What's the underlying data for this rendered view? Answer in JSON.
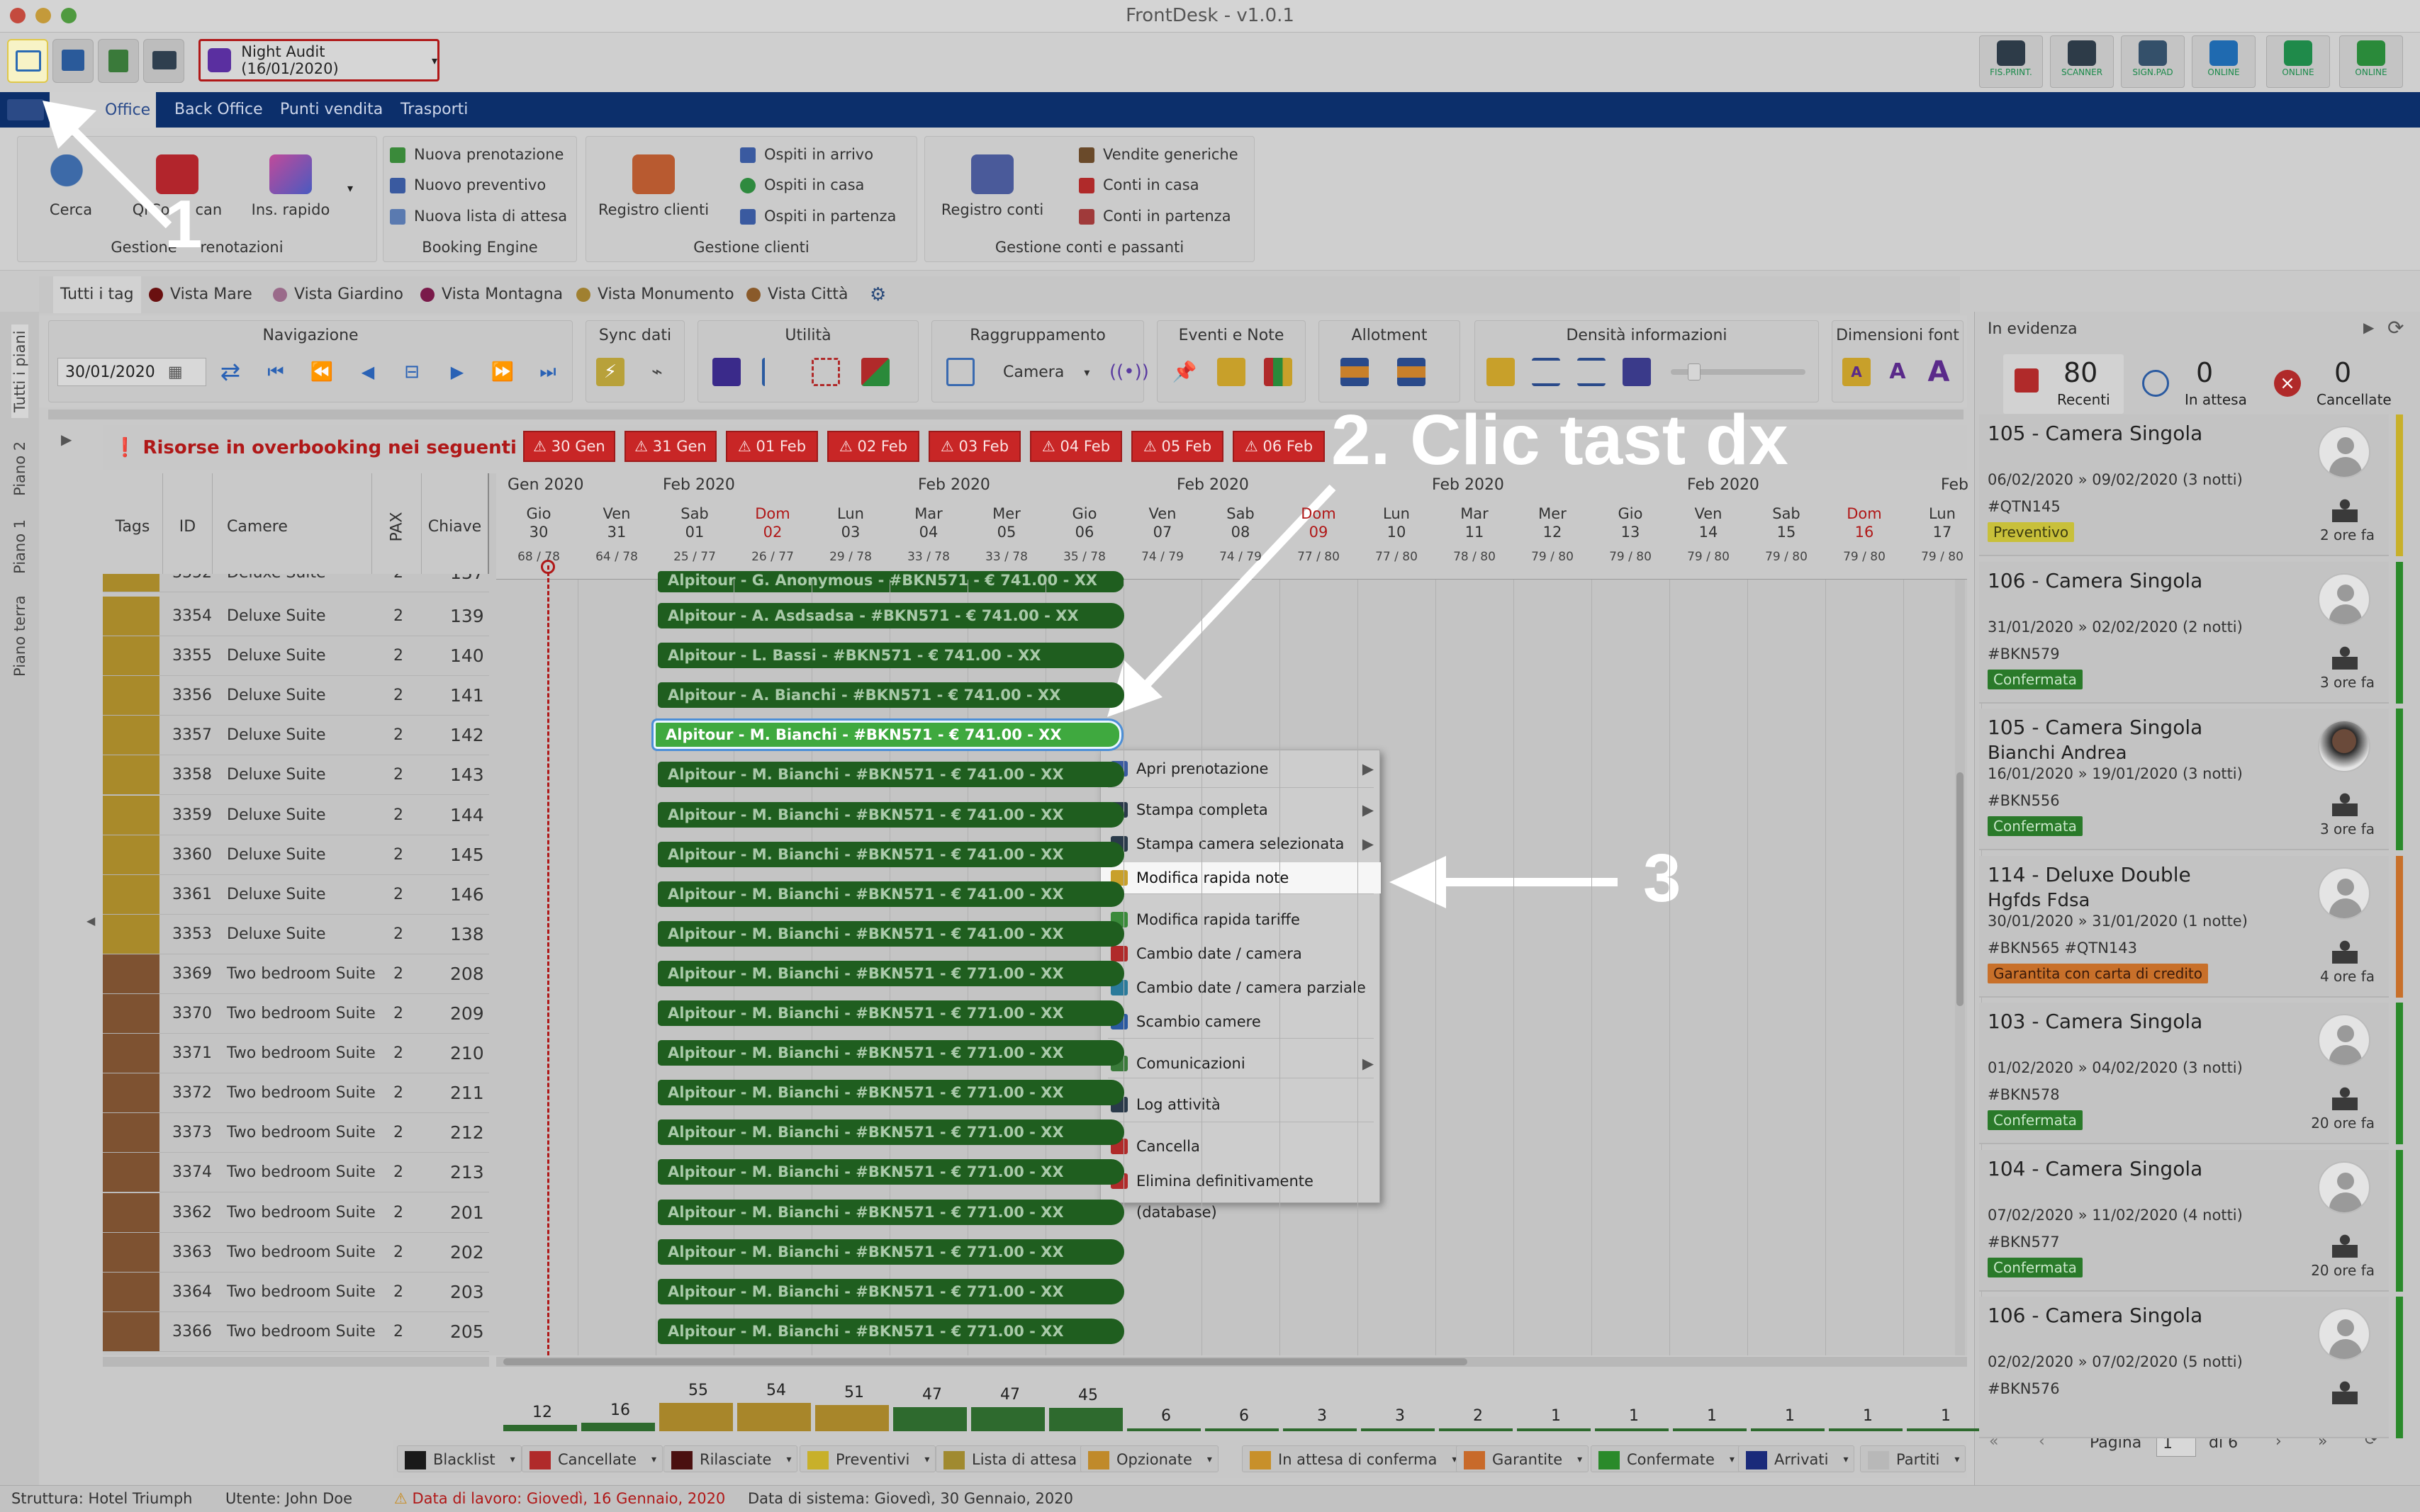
{
  "window": {
    "title": "FrontDesk - v1.0.1"
  },
  "toolbar": {
    "night_audit": "Night Audit (16/01/2020)",
    "right_buttons": [
      "FIS.PRINT.",
      "SCANNER",
      "SIGN.PAD",
      "ONLINE",
      "ONLINE",
      "ONLINE"
    ]
  },
  "menu": {
    "items": [
      "Front Office",
      "Back Office",
      "Punti vendita",
      "Trasporti"
    ],
    "first_visible": "Office"
  },
  "ribbon": {
    "cerca": "Cerca",
    "qrcode": "QrCode scan",
    "qrcode_a": "QrCo",
    "qrcode_b": "can",
    "ins_rapido": "Ins. rapido",
    "gestione_prenotazioni": "Gestione prenotazioni",
    "gp_a": "Gestione",
    "gp_b": "renotazioni",
    "nuova_prenotazione": "Nuova prenotazione",
    "nuovo_preventivo": "Nuovo preventivo",
    "nuova_lista": "Nuova lista di attesa",
    "booking_engine": "Booking Engine",
    "registro_clienti": "Registro clienti",
    "ospiti_arrivo": "Ospiti in arrivo",
    "ospiti_casa": "Ospiti in casa",
    "ospiti_partenza": "Ospiti in partenza",
    "gestione_clienti": "Gestione clienti",
    "registro_conti": "Registro conti",
    "vendite_generiche": "Vendite generiche",
    "conti_casa": "Conti in casa",
    "conti_partenza": "Conti in partenza",
    "gestione_conti": "Gestione conti e passanti"
  },
  "tags": [
    "Tutti i tag",
    "Vista Mare",
    "Vista Giardino",
    "Vista Montagna",
    "Vista Monumento",
    "Vista Città"
  ],
  "vtabs": [
    "Tutti i piani",
    "Piano 2",
    "Piano 1",
    "Piano terra"
  ],
  "nav": {
    "navigazione": "Navigazione",
    "date": "30/01/2020",
    "sync": "Sync dati",
    "utilita": "Utilità",
    "raggruppamento": "Raggruppamento",
    "raggruppamento_value": "Camera",
    "eventi": "Eventi e Note",
    "allotment": "Allotment",
    "densita": "Densità informazioni",
    "font": "Dimensioni font",
    "font_letters": [
      "A",
      "A",
      "A"
    ]
  },
  "overbooking": {
    "label": "Risorse in overbooking nei seguenti giorni:",
    "days": [
      "30 Gen",
      "31 Gen",
      "01 Feb",
      "02 Feb",
      "03 Feb",
      "04 Feb",
      "05 Feb",
      "06 Feb"
    ]
  },
  "grid": {
    "headers": {
      "tags": "Tags",
      "id": "ID",
      "camere": "Camere",
      "pax": "PAX",
      "chiave": "Chiave"
    },
    "months": [
      "Gen 2020",
      "Feb 2020",
      "Feb 2020",
      "Feb 2020",
      "Feb 2020",
      "Feb 2020",
      "Feb"
    ],
    "days": [
      {
        "d": "Gio",
        "n": "30",
        "occ": "68 / 78",
        "red": false
      },
      {
        "d": "Ven",
        "n": "31",
        "occ": "64 / 78",
        "red": false
      },
      {
        "d": "Sab",
        "n": "01",
        "occ": "25 / 77",
        "red": false
      },
      {
        "d": "Dom",
        "n": "02",
        "occ": "26 / 77",
        "red": true
      },
      {
        "d": "Lun",
        "n": "03",
        "occ": "29 / 78",
        "red": false
      },
      {
        "d": "Mar",
        "n": "04",
        "occ": "33 / 78",
        "red": false
      },
      {
        "d": "Mer",
        "n": "05",
        "occ": "33 / 78",
        "red": false
      },
      {
        "d": "Gio",
        "n": "06",
        "occ": "35 / 78",
        "red": false
      },
      {
        "d": "Ven",
        "n": "07",
        "occ": "74 / 79",
        "red": false
      },
      {
        "d": "Sab",
        "n": "08",
        "occ": "74 / 79",
        "red": false
      },
      {
        "d": "Dom",
        "n": "09",
        "occ": "77 / 80",
        "red": true
      },
      {
        "d": "Lun",
        "n": "10",
        "occ": "77 / 80",
        "red": false
      },
      {
        "d": "Mar",
        "n": "11",
        "occ": "78 / 80",
        "red": false
      },
      {
        "d": "Mer",
        "n": "12",
        "occ": "79 / 80",
        "red": false
      },
      {
        "d": "Gio",
        "n": "13",
        "occ": "79 / 80",
        "red": false
      },
      {
        "d": "Ven",
        "n": "14",
        "occ": "79 / 80",
        "red": false
      },
      {
        "d": "Sab",
        "n": "15",
        "occ": "79 / 80",
        "red": false
      },
      {
        "d": "Dom",
        "n": "16",
        "occ": "79 / 80",
        "red": true
      },
      {
        "d": "Lun",
        "n": "17",
        "occ": "79 / 80",
        "red": false
      }
    ],
    "top_row": {
      "id": "3352",
      "cam": "Deluxe Suite",
      "pax": "2",
      "key": "137",
      "bar": "Alpitour - G. Anonymous - #BKN571 - € 741.00 - XX"
    },
    "rows": [
      {
        "id": "3354",
        "cam": "Deluxe Suite",
        "pax": "2",
        "key": "139",
        "bar": "Alpitour - A. Asdsadsa - #BKN571 - € 741.00 - XX",
        "tag": "#a98a2a"
      },
      {
        "id": "3355",
        "cam": "Deluxe Suite",
        "pax": "2",
        "key": "140",
        "bar": "Alpitour - L. Bassi - #BKN571 - € 741.00 - XX",
        "tag": "#a98a2a"
      },
      {
        "id": "3356",
        "cam": "Deluxe Suite",
        "pax": "2",
        "key": "141",
        "bar": "Alpitour - A. Bianchi - #BKN571 - € 741.00 - XX",
        "tag": "#a98a2a"
      },
      {
        "id": "3357",
        "cam": "Deluxe Suite",
        "pax": "2",
        "key": "142",
        "bar": "Alpitour - M. Bianchi - #BKN571 - € 741.00 - XX",
        "tag": "#a98a2a",
        "sel": true
      },
      {
        "id": "3358",
        "cam": "Deluxe Suite",
        "pax": "2",
        "key": "143",
        "bar": "Alpitour - M. Bianchi - #BKN571 - € 741.00 - XX",
        "tag": "#a98a2a"
      },
      {
        "id": "3359",
        "cam": "Deluxe Suite",
        "pax": "2",
        "key": "144",
        "bar": "Alpitour - M. Bianchi - #BKN571 - € 741.00 - XX",
        "tag": "#a98a2a"
      },
      {
        "id": "3360",
        "cam": "Deluxe Suite",
        "pax": "2",
        "key": "145",
        "bar": "Alpitour - M. Bianchi - #BKN571 - € 741.00 - XX",
        "tag": "#a98a2a"
      },
      {
        "id": "3361",
        "cam": "Deluxe Suite",
        "pax": "2",
        "key": "146",
        "bar": "Alpitour - M. Bianchi - #BKN571 - € 741.00 - XX",
        "tag": "#a98a2a"
      },
      {
        "id": "3353",
        "cam": "Deluxe Suite",
        "pax": "2",
        "key": "138",
        "bar": "Alpitour - M. Bianchi - #BKN571 - € 741.00 - XX",
        "tag": "#a98a2a"
      },
      {
        "id": "3369",
        "cam": "Two bedroom Suite",
        "pax": "2",
        "key": "208",
        "bar": "Alpitour - M. Bianchi - #BKN571 - € 771.00 - XX",
        "tag": "#7e5231"
      },
      {
        "id": "3370",
        "cam": "Two bedroom Suite",
        "pax": "2",
        "key": "209",
        "bar": "Alpitour - M. Bianchi - #BKN571 - € 771.00 - XX",
        "tag": "#7e5231"
      },
      {
        "id": "3371",
        "cam": "Two bedroom Suite",
        "pax": "2",
        "key": "210",
        "bar": "Alpitour - M. Bianchi - #BKN571 - € 771.00 - XX",
        "tag": "#7e5231"
      },
      {
        "id": "3372",
        "cam": "Two bedroom Suite",
        "pax": "2",
        "key": "211",
        "bar": "Alpitour - M. Bianchi - #BKN571 - € 771.00 - XX",
        "tag": "#7e5231"
      },
      {
        "id": "3373",
        "cam": "Two bedroom Suite",
        "pax": "2",
        "key": "212",
        "bar": "Alpitour - M. Bianchi - #BKN571 - € 771.00 - XX",
        "tag": "#7e5231"
      },
      {
        "id": "3374",
        "cam": "Two bedroom Suite",
        "pax": "2",
        "key": "213",
        "bar": "Alpitour - M. Bianchi - #BKN571 - € 771.00 - XX",
        "tag": "#7e5231"
      },
      {
        "id": "3362",
        "cam": "Two bedroom Suite",
        "pax": "2",
        "key": "201",
        "bar": "Alpitour - M. Bianchi - #BKN571 - € 771.00 - XX",
        "tag": "#7e5231"
      },
      {
        "id": "3363",
        "cam": "Two bedroom Suite",
        "pax": "2",
        "key": "202",
        "bar": "Alpitour - M. Bianchi - #BKN571 - € 771.00 - XX",
        "tag": "#7e5231"
      },
      {
        "id": "3364",
        "cam": "Two bedroom Suite",
        "pax": "2",
        "key": "203",
        "bar": "Alpitour - M. Bianchi - #BKN571 - € 771.00 - XX",
        "tag": "#7e5231"
      },
      {
        "id": "3366",
        "cam": "Two bedroom Suite",
        "pax": "2",
        "key": "205",
        "bar": "Alpitour - M. Bianchi - #BKN571 - € 771.00 - XX",
        "tag": "#7e5231"
      }
    ],
    "counts": [
      "12",
      "16",
      "55",
      "54",
      "51",
      "47",
      "47",
      "45",
      "6",
      "6",
      "3",
      "3",
      "2",
      "1",
      "1",
      "1",
      "1",
      "1",
      "1"
    ]
  },
  "context_menu": [
    "Apri prenotazione",
    "Stampa completa",
    "Stampa camera selezionata",
    "Modifica rapida note",
    "Modifica rapida tariffe",
    "Cambio date / camera",
    "Cambio date / camera parziale",
    "Scambio camere",
    "Comunicazioni",
    "Log attività",
    "Cancella",
    "Elimina definitivamente (database)"
  ],
  "legend": [
    "Blacklist",
    "Cancellate",
    "Rilasciate",
    "Preventivi",
    "Lista di attesa",
    "Opzionate",
    "In attesa di conferma",
    "Garantite",
    "Confermate",
    "Arrivati",
    "Partiti"
  ],
  "status": {
    "struttura": "Struttura: Hotel Triumph",
    "utente": "Utente: John Doe",
    "lavoro": "Data di lavoro: Giovedì, 16 Gennaio, 2020",
    "sistema": "Data di sistema: Giovedì, 30 Gennaio, 2020"
  },
  "right_panel": {
    "title": "In evidenza",
    "stats": [
      {
        "n": "80",
        "l": "Recenti"
      },
      {
        "n": "0",
        "l": "In attesa"
      },
      {
        "n": "0",
        "l": "Cancellate"
      }
    ],
    "cards": [
      {
        "title": "105 - Camera Singola",
        "guest": "",
        "dates": "06/02/2020 » 09/02/2020 (3 notti)",
        "code": "#QTN145",
        "badge": "Preventivo",
        "ago": "2 ore fa"
      },
      {
        "title": "106 - Camera Singola",
        "guest": "",
        "dates": "31/01/2020 » 02/02/2020 (2 notti)",
        "code": "#BKN579",
        "badge": "Confermata",
        "ago": "3 ore fa"
      },
      {
        "title": "105 - Camera Singola",
        "guest": "Bianchi Andrea",
        "dates": "16/01/2020 » 19/01/2020 (3 notti)",
        "code": "#BKN556",
        "badge": "Confermata",
        "ago": "3 ore fa"
      },
      {
        "title": "114 - Deluxe Double",
        "guest": "Hgfds Fdsa",
        "dates": "30/01/2020 » 31/01/2020 (1 notte)",
        "code": "#BKN565 #QTN143",
        "badge": "Garantita con carta di credito",
        "ago": "4 ore fa"
      },
      {
        "title": "103 - Camera Singola",
        "guest": "",
        "dates": "01/02/2020 » 04/02/2020 (3 notti)",
        "code": "#BKN578",
        "badge": "Confermata",
        "ago": "20 ore fa"
      },
      {
        "title": "104 - Camera Singola",
        "guest": "",
        "dates": "07/02/2020 » 11/02/2020 (4 notti)",
        "code": "#BKN577",
        "badge": "Confermata",
        "ago": "20 ore fa"
      },
      {
        "title": "106 - Camera Singola",
        "guest": "",
        "dates": "02/02/2020 » 07/02/2020 (5 notti)",
        "code": "#BKN576",
        "badge": "",
        "ago": ""
      }
    ],
    "pager": {
      "label": "Pagina",
      "page": "1",
      "of": "di 6"
    }
  },
  "annotations": {
    "a1": "1",
    "a2": "2. Clic tast dx",
    "a3": "3"
  }
}
